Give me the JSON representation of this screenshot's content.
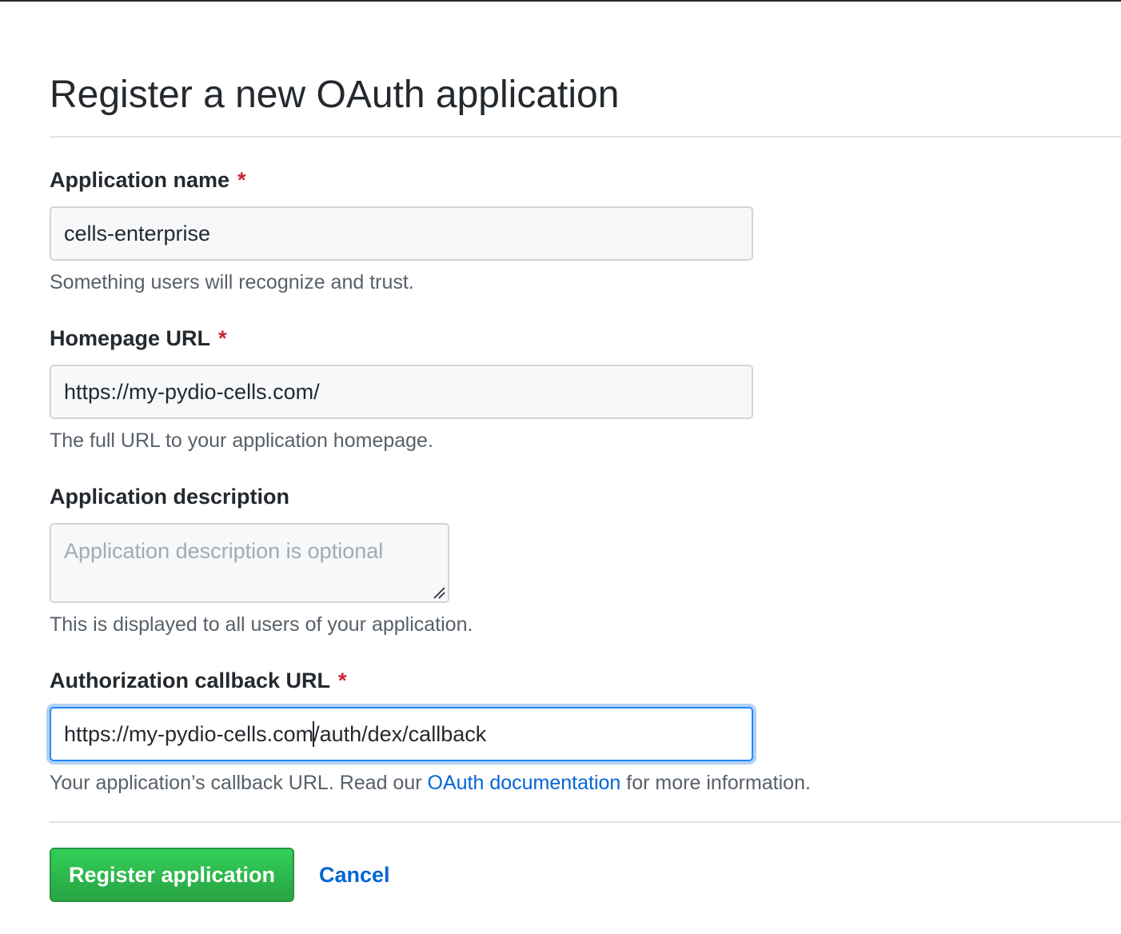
{
  "page": {
    "title": "Register a new OAuth application"
  },
  "form": {
    "required_marker": "*",
    "app_name": {
      "label": "Application name",
      "value": "cells-enterprise",
      "help": "Something users will recognize and trust."
    },
    "homepage_url": {
      "label": "Homepage URL",
      "value": "https://my-pydio-cells.com/",
      "help": "The full URL to your application homepage."
    },
    "description": {
      "label": "Application description",
      "value": "",
      "placeholder": "Application description is optional",
      "help": "This is displayed to all users of your application."
    },
    "callback_url": {
      "label": "Authorization callback URL",
      "value_before_caret": "https://my-pydio-cells.com",
      "value_after_caret": "/auth/dex/callback",
      "help_before": "Your application’s callback URL. Read our",
      "help_link": "OAuth documentation",
      "help_after": "for more information."
    }
  },
  "actions": {
    "submit_label": "Register application",
    "cancel_label": "Cancel"
  },
  "colors": {
    "required": "#cb2431",
    "link": "#0366d6",
    "primary_button": "#28a745",
    "focus_border": "#2188ff"
  }
}
